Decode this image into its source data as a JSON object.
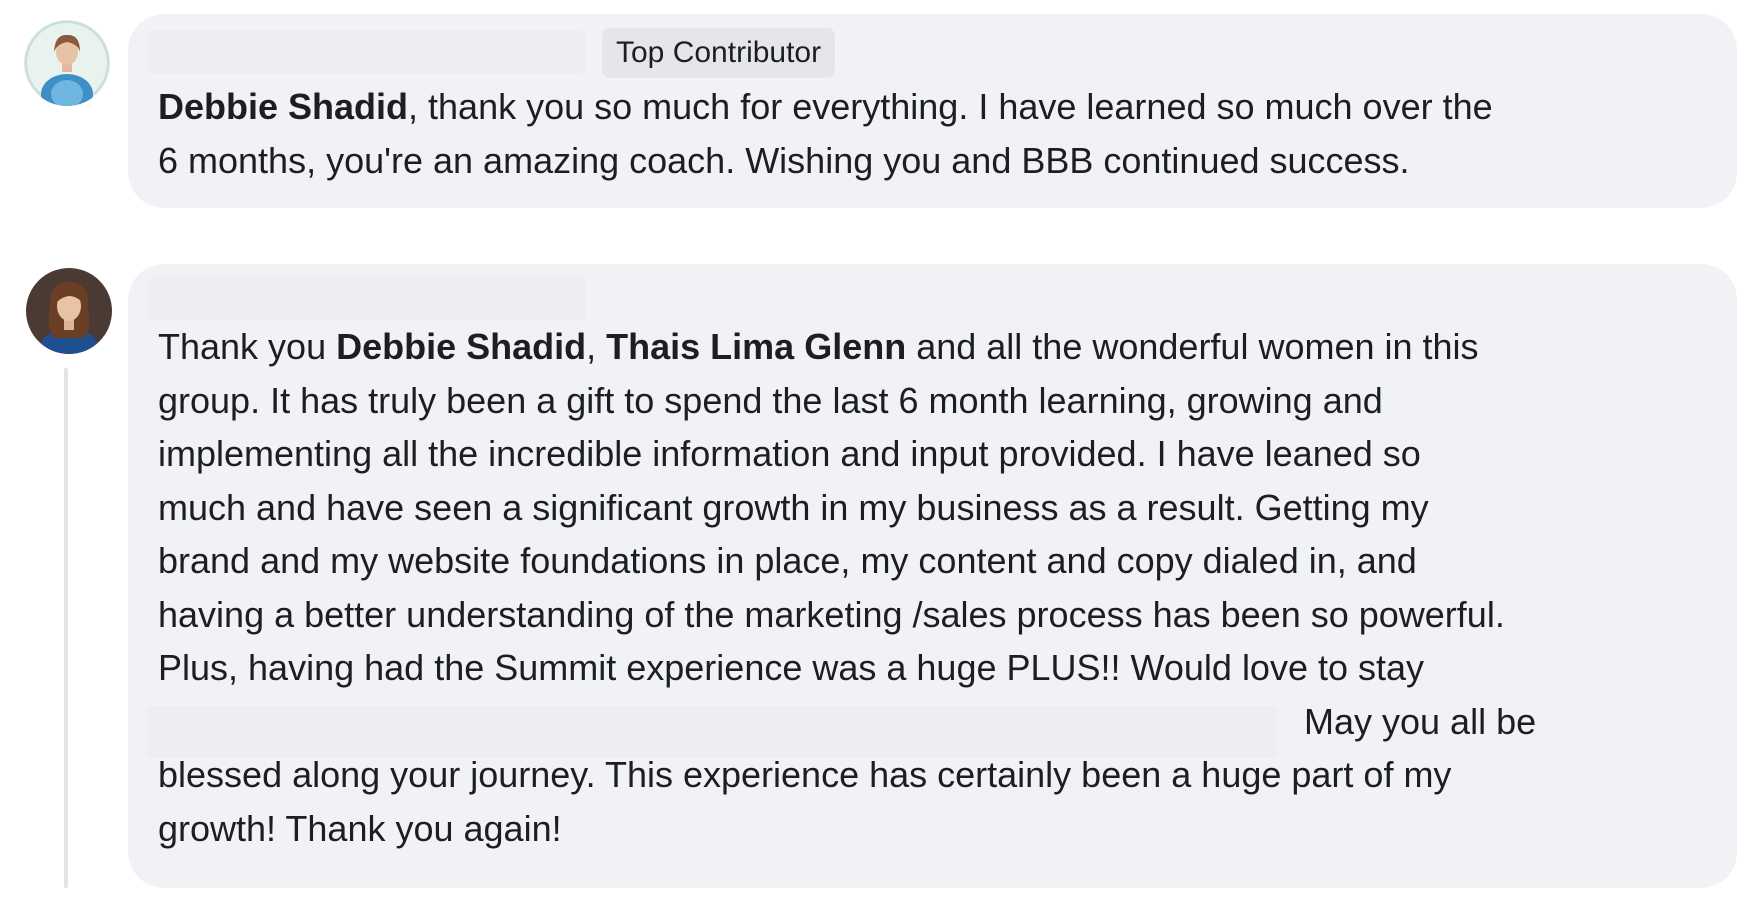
{
  "comments": [
    {
      "badge": "Top Contributor",
      "mention": "Debbie Shadid",
      "lines": [
        ", thank you so much for everything. I have learned so much over the",
        "6 months, you're an amazing coach. Wishing you and BBB continued success."
      ]
    },
    {
      "prefix": "Thank you ",
      "mention_1": "Debbie Shadid",
      "separator": ", ",
      "mention_2": "Thais Lima Glenn",
      "lines": [
        " and all the wonderful women in this",
        "group. It has truly been a gift to spend the last 6 month learning, growing and",
        "implementing all the incredible information and input provided. I have leaned so",
        "much and have seen a significant growth in my business as a result. Getting my",
        "brand and my website foundations in place, my content and copy dialed in, and",
        "having a better understanding of the marketing /sales process has been so powerful.",
        "Plus, having had the Summit experience was a huge PLUS!! Would love to stay",
        "May you all be",
        "blessed along your journey. This experience has certainly been a huge part of my",
        "growth! Thank you again!"
      ]
    }
  ]
}
